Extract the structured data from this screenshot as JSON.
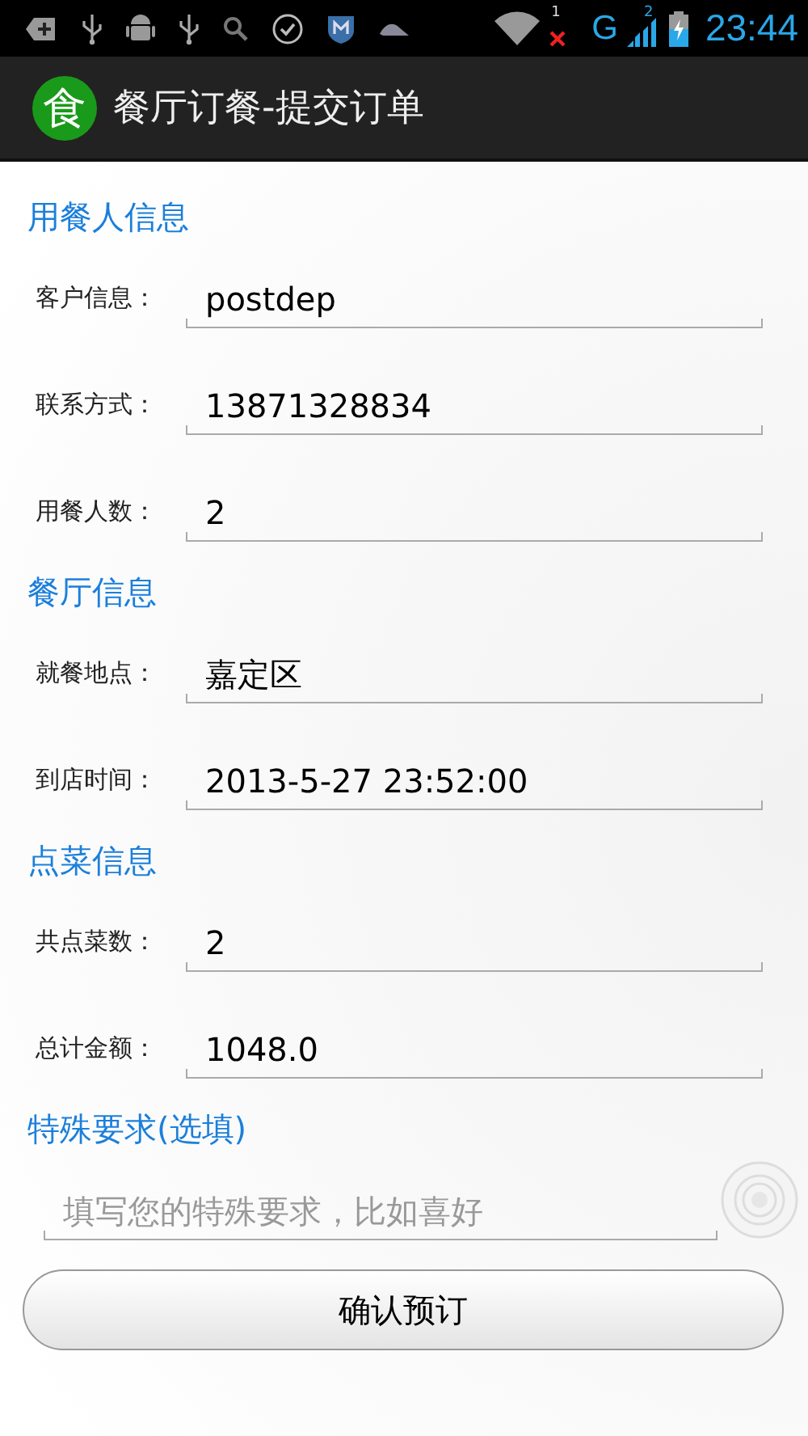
{
  "status_bar": {
    "sim1_label": "1",
    "network_type": "G",
    "sim2_label": "2",
    "time": "23:44"
  },
  "action_bar": {
    "logo_char": "食",
    "title": "餐厅订餐-提交订单"
  },
  "sections": [
    {
      "title": "用餐人信息",
      "fields": [
        {
          "label": "客户信息：",
          "value": "postdep"
        },
        {
          "label": "联系方式：",
          "value": "13871328834"
        },
        {
          "label": "用餐人数：",
          "value": "2"
        }
      ]
    },
    {
      "title": "餐厅信息",
      "fields": [
        {
          "label": "就餐地点：",
          "value": "嘉定区"
        },
        {
          "label": "到店时间：",
          "value": "2013-5-27 23:52:00"
        }
      ]
    },
    {
      "title": "点菜信息",
      "fields": [
        {
          "label": "共点菜数：",
          "value": "2"
        },
        {
          "label": "总计金额：",
          "value": "1048.0"
        }
      ]
    }
  ],
  "special": {
    "title": "特殊要求(选填)",
    "placeholder": "填写您的特殊要求，比如喜好"
  },
  "submit_button": "确认预订"
}
